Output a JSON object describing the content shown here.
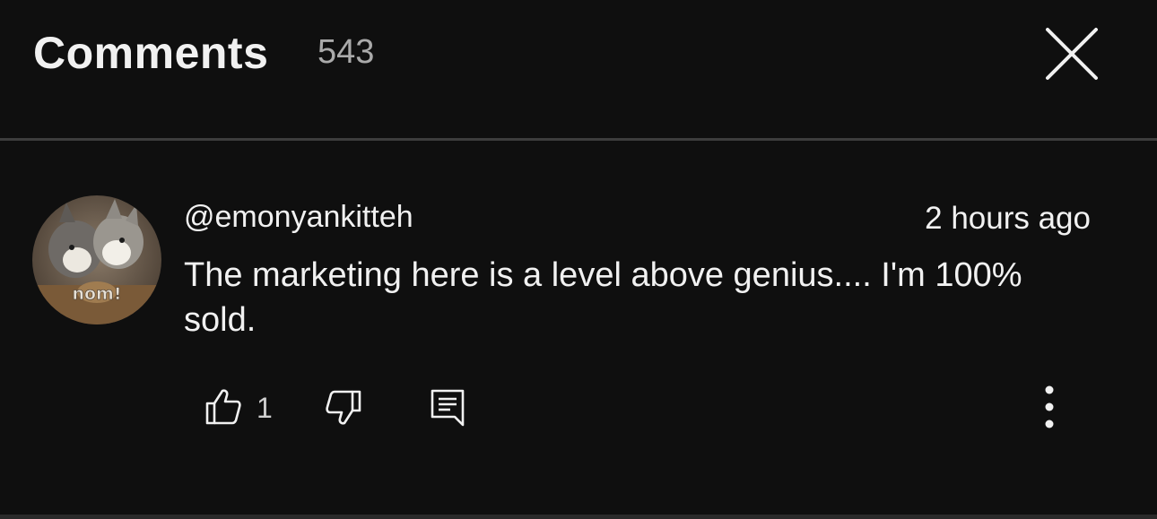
{
  "header": {
    "title": "Comments",
    "count": "543",
    "close_icon": "close-icon"
  },
  "comment": {
    "author": "@emonyankitteh",
    "timestamp": "2 hours ago",
    "text": "The marketing here is a level above genius.... I'm 100% sold.",
    "avatar_caption": "nom!",
    "likes": "1",
    "icons": {
      "like": "thumbs-up-icon",
      "dislike": "thumbs-down-icon",
      "reply": "reply-icon",
      "more": "more-vertical-icon"
    }
  },
  "colors": {
    "background": "#0f0f0f",
    "text": "#f1f1f1",
    "secondary_text": "#aaaaaa",
    "divider": "#3d3d3d"
  }
}
